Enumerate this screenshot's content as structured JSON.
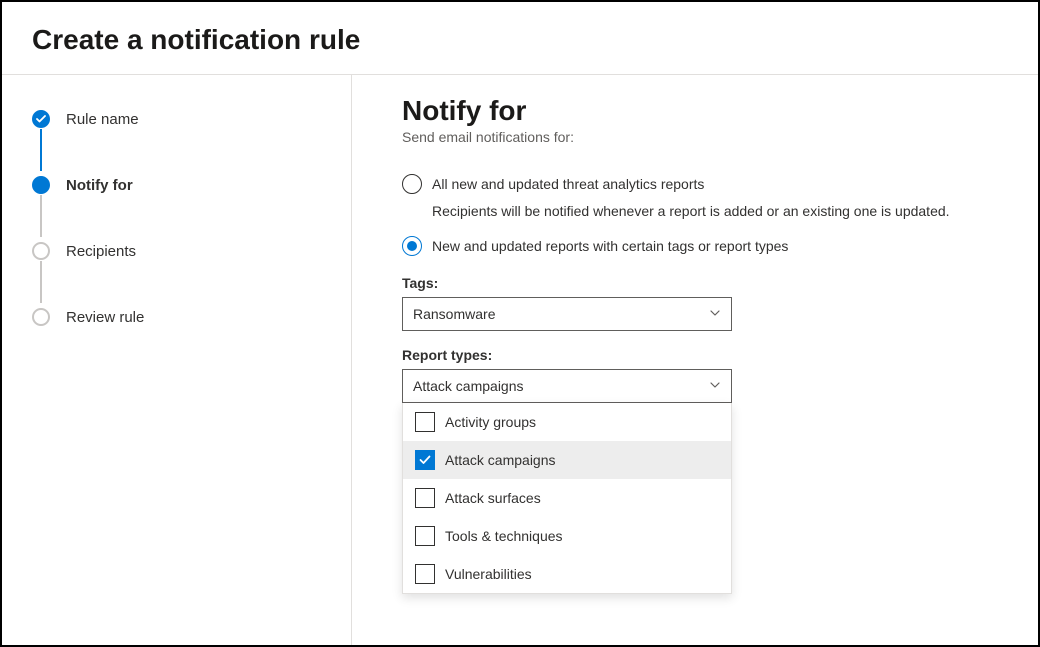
{
  "header": {
    "title": "Create a notification rule"
  },
  "sidebar": {
    "steps": [
      {
        "label": "Rule name",
        "state": "completed"
      },
      {
        "label": "Notify for",
        "state": "current"
      },
      {
        "label": "Recipients",
        "state": "upcoming"
      },
      {
        "label": "Review rule",
        "state": "upcoming"
      }
    ]
  },
  "main": {
    "heading": "Notify for",
    "sub": "Send email notifications for:",
    "radios": {
      "all": {
        "label": "All new and updated threat analytics reports",
        "desc": "Recipients will be notified whenever a report is added or an existing one is updated.",
        "selected": false
      },
      "filtered": {
        "label": "New and updated reports with certain tags or report types",
        "selected": true
      }
    },
    "tags": {
      "label": "Tags:",
      "selected": "Ransomware"
    },
    "report_types": {
      "label": "Report types:",
      "selected": "Attack campaigns",
      "options": [
        {
          "label": "Activity groups",
          "checked": false
        },
        {
          "label": "Attack campaigns",
          "checked": true
        },
        {
          "label": "Attack surfaces",
          "checked": false
        },
        {
          "label": "Tools & techniques",
          "checked": false
        },
        {
          "label": "Vulnerabilities",
          "checked": false
        }
      ]
    }
  },
  "colors": {
    "accent": "#0078d4"
  }
}
